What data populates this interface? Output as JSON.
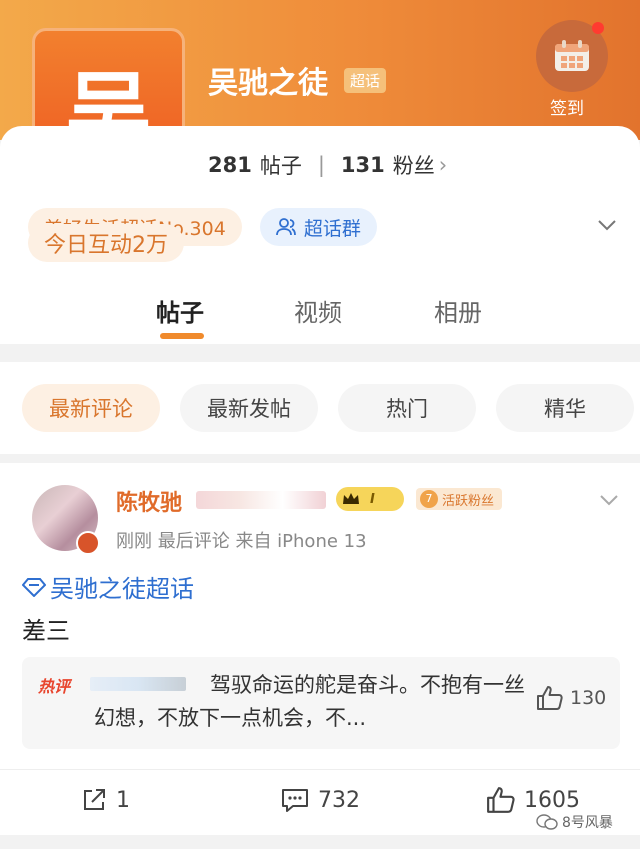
{
  "header": {
    "avatar_char": "吴",
    "title": "吴驰之徒",
    "badge": "超话",
    "checkin_label": "签到",
    "stats": {
      "posts_count": "281",
      "posts_label": "帖子",
      "fans_count": "131",
      "fans_label": "粉丝"
    },
    "chips": {
      "rank": "美好生活超话No.304",
      "activity": "今日互动2万",
      "group": "超话群"
    }
  },
  "tabs": [
    "帖子",
    "视频",
    "相册"
  ],
  "filters": [
    "最新评论",
    "最新发帖",
    "热门",
    "精华"
  ],
  "post": {
    "author": "陈牧驰",
    "crown_level": "I",
    "fan_level": "7",
    "fan_badge": "活跃粉丝",
    "meta": "刚刚 最后评论  来自 iPhone 13",
    "topic": "吴驰之徒超话",
    "body": "差三",
    "hot_comment": {
      "tag": "热评",
      "text": "驾驭命运的舵是奋斗。不抱有一丝幻想，不放下一点机会，不...",
      "likes": "130"
    },
    "actions": {
      "share": "1",
      "comment": "732",
      "like": "1605"
    }
  },
  "watermark": "8号风暴",
  "colors": {
    "accent": "#f08a2c",
    "link": "#2f6fd0",
    "hot": "#e8452e"
  }
}
